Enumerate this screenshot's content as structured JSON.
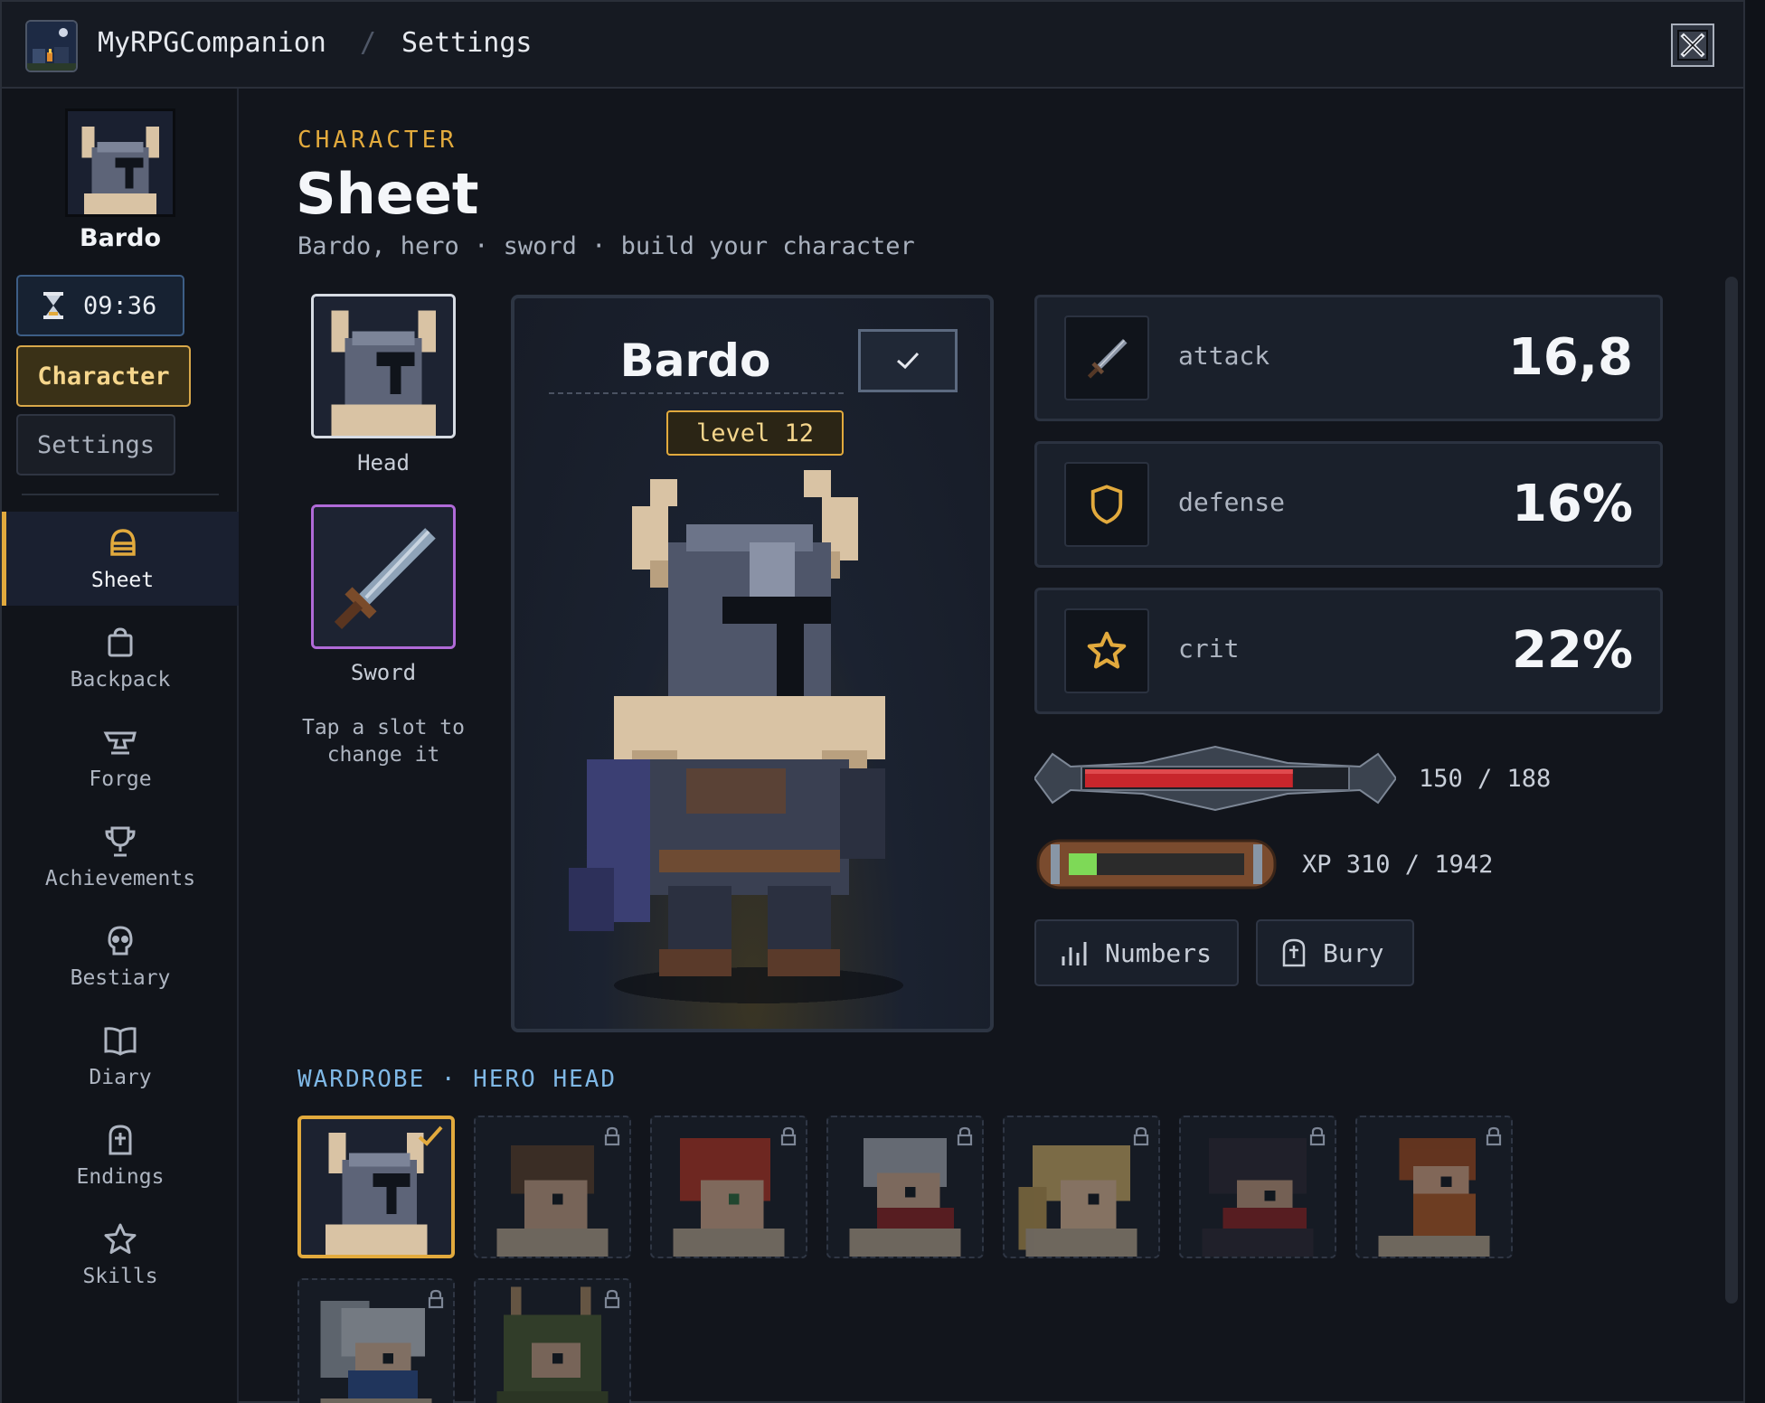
{
  "titlebar": {
    "app_name": "MyRPGCompanion",
    "separator": "/",
    "page": "Settings"
  },
  "sidebar": {
    "character_name": "Bardo",
    "timer": "09:36",
    "character_button": "Character",
    "settings_button": "Settings",
    "nav": [
      {
        "label": "Sheet",
        "icon": "helmet-icon",
        "active": true
      },
      {
        "label": "Backpack",
        "icon": "backpack-icon"
      },
      {
        "label": "Forge",
        "icon": "anvil-icon"
      },
      {
        "label": "Achievements",
        "icon": "trophy-icon"
      },
      {
        "label": "Bestiary",
        "icon": "skull-icon"
      },
      {
        "label": "Diary",
        "icon": "book-icon"
      },
      {
        "label": "Endings",
        "icon": "gravestone-icon"
      },
      {
        "label": "Skills",
        "icon": "star-icon"
      }
    ]
  },
  "main": {
    "eyebrow": "CHARACTER",
    "title": "Sheet",
    "subtitle": "Bardo, hero · sword · build your character"
  },
  "equipment": {
    "head_label": "Head",
    "sword_label": "Sword",
    "hint": "Tap a slot to change it"
  },
  "hero": {
    "name": "Bardo",
    "level": "level 12"
  },
  "stats": [
    {
      "label": "attack",
      "value": "16,8",
      "icon": "sword-icon"
    },
    {
      "label": "defense",
      "value": "16%",
      "icon": "shield-icon"
    },
    {
      "label": "crit",
      "value": "22%",
      "icon": "star-icon"
    }
  ],
  "health": {
    "text": "150 / 188",
    "current": 150,
    "max": 188
  },
  "xp": {
    "text": "XP 310 / 1942",
    "current": 310,
    "max": 1942
  },
  "actions": {
    "numbers": "Numbers",
    "bury": "Bury"
  },
  "wardrobe": {
    "title": "WARDROBE · HERO HEAD",
    "items": [
      {
        "name": "horned-helmet",
        "selected": true,
        "locked": false
      },
      {
        "name": "brown-hair",
        "locked": true
      },
      {
        "name": "red-hair",
        "locked": true
      },
      {
        "name": "grey-hair-scarf",
        "locked": true
      },
      {
        "name": "blonde-hair",
        "locked": true
      },
      {
        "name": "dark-hair-scarf",
        "locked": true
      },
      {
        "name": "ginger-beard",
        "locked": true
      },
      {
        "name": "silver-hair-mask",
        "locked": true
      },
      {
        "name": "antler-hood",
        "locked": true
      }
    ]
  },
  "colors": {
    "accent": "#e2aa3d",
    "health": "#c8262c",
    "xp": "#7ed957",
    "rare": "#b06ad8"
  }
}
